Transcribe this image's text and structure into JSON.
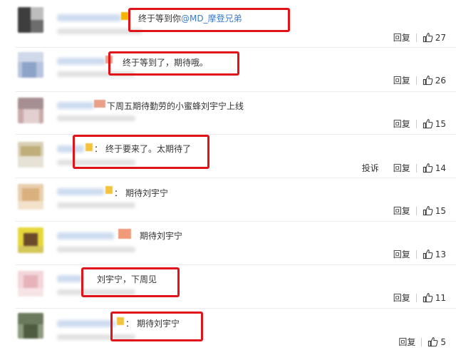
{
  "actions": {
    "reply_label": "回复",
    "report_label": "投诉"
  },
  "colors": {
    "highlight": "#e0121a",
    "mention": "#3a7ccf",
    "text": "#333333"
  },
  "comments": [
    {
      "prefix": "",
      "text": "终于等到你",
      "mention": "@MD_摩登兄弟",
      "likes": "27",
      "highlighted": true
    },
    {
      "prefix": "",
      "text": "终于等到了，期待哦。",
      "mention": "",
      "likes": "26",
      "highlighted": true
    },
    {
      "prefix": "",
      "text": "下周五期待勤劳的小蜜蜂刘宇宁上线",
      "mention": "",
      "likes": "15",
      "highlighted": false
    },
    {
      "prefix": "：",
      "text": "终于要来了。太期待了",
      "mention": "",
      "likes": "14",
      "highlighted": true,
      "has_report": true
    },
    {
      "prefix": "：",
      "text": "期待刘宇宁",
      "mention": "",
      "likes": "15",
      "highlighted": false
    },
    {
      "prefix": "",
      "text": "期待刘宇宁",
      "mention": "",
      "likes": "13",
      "highlighted": false
    },
    {
      "prefix": "",
      "text": "刘宇宁，下周见",
      "mention": "",
      "likes": "11",
      "highlighted": true
    },
    {
      "prefix": "：",
      "text": "期待刘宇宁",
      "mention": "",
      "likes": "5",
      "highlighted": true
    }
  ]
}
